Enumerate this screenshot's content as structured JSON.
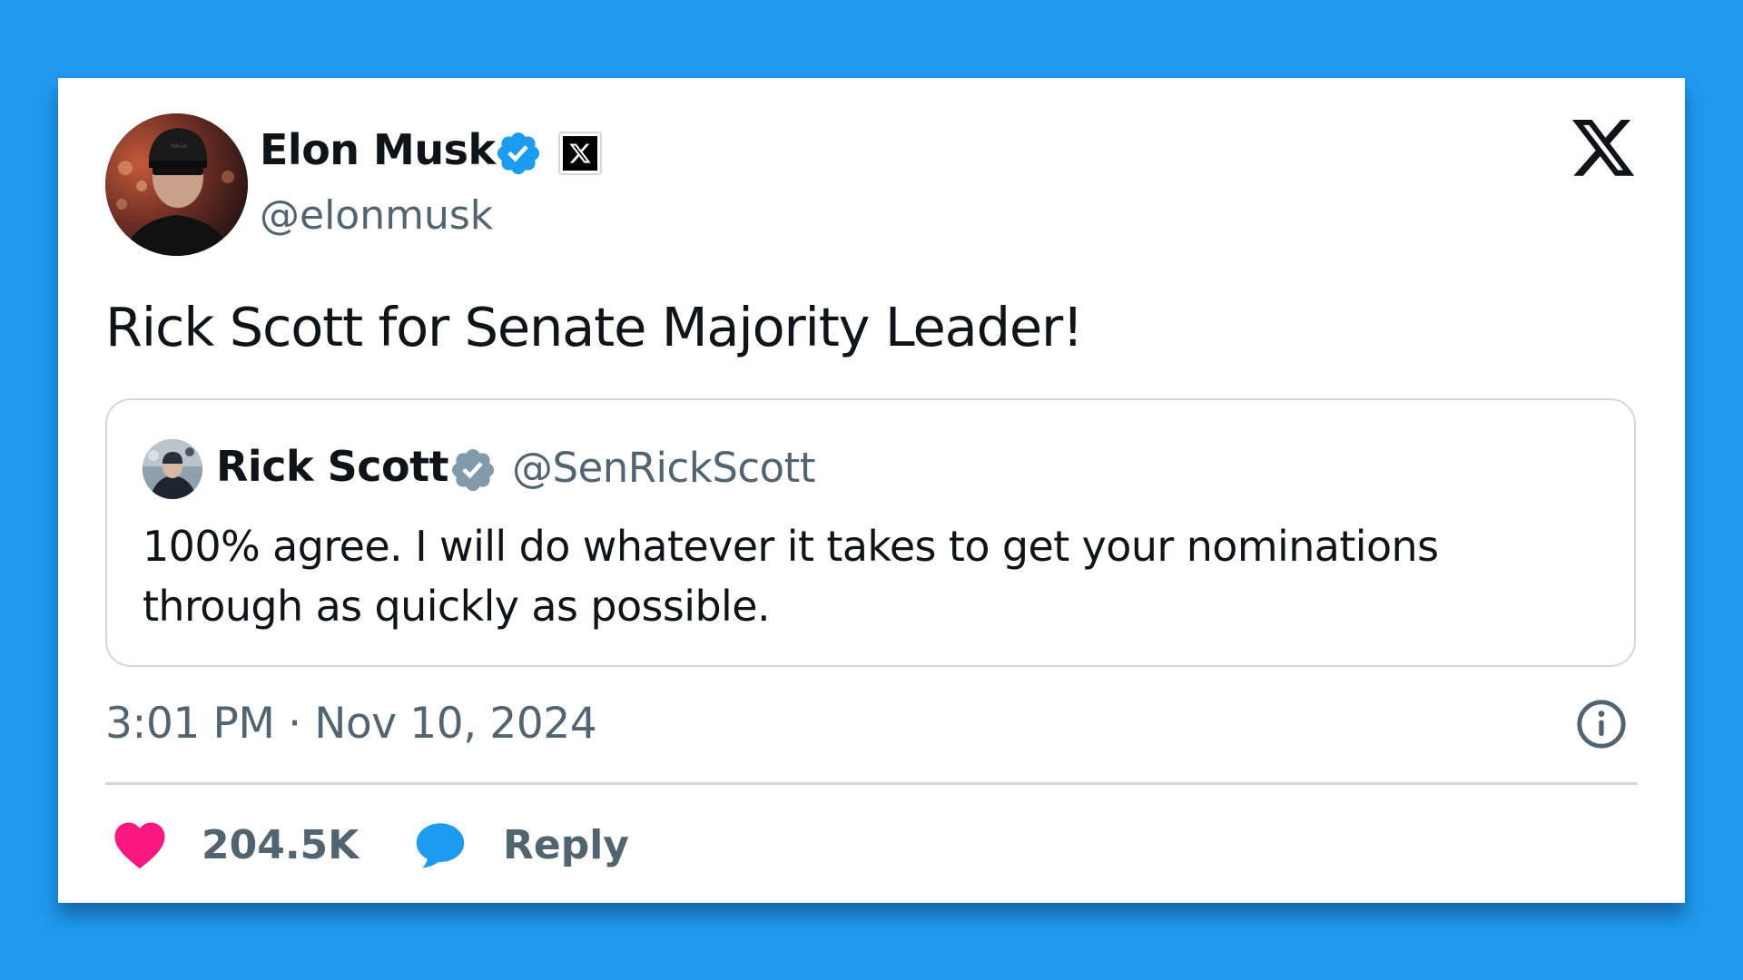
{
  "tweet": {
    "author": {
      "name": "Elon Musk",
      "handle": "@elonmusk",
      "verified": true,
      "affiliate_badge_icon": "x-logo-icon"
    },
    "text": "Rick Scott for Senate Majority Leader!",
    "quoted_tweet": {
      "author": {
        "name": "Rick Scott",
        "handle": "@SenRickScott",
        "verified": true,
        "badge_color": "#829aab"
      },
      "text": "100% agree. I will do whatever it takes to get your nominations through as quickly as possible."
    },
    "timestamp": "3:01 PM · Nov 10, 2024",
    "actions": {
      "likes": "204.5K",
      "reply_label": "Reply"
    }
  },
  "colors": {
    "background": "#1F9AEF",
    "card": "#ffffff",
    "verified_blue": "#1D9BF0",
    "like_pink": "#F91880",
    "reply_blue": "#1D9BF0",
    "secondary_text": "#536471"
  }
}
